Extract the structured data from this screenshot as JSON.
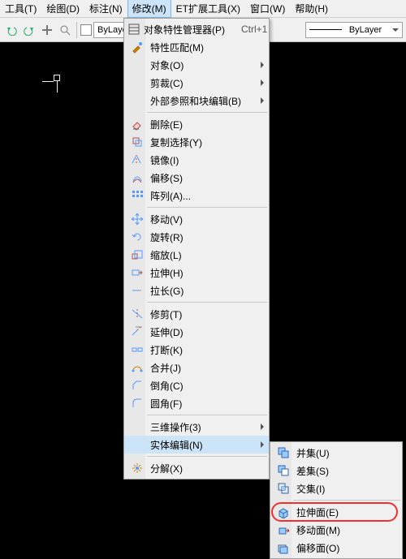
{
  "menubar": {
    "items": [
      {
        "label": "工具(T)"
      },
      {
        "label": "绘图(D)"
      },
      {
        "label": "标注(N)"
      },
      {
        "label": "修改(M)",
        "active": true
      },
      {
        "label": "ET扩展工具(X)"
      },
      {
        "label": "窗口(W)"
      },
      {
        "label": "帮助(H)"
      }
    ]
  },
  "toolbar": {
    "layer_label": "ByLayer",
    "linetype_label": "ByLayer"
  },
  "menu_modify": {
    "items": [
      {
        "icon": "properties",
        "label": "对象特性管理器(P)",
        "shortcut": "Ctrl+1"
      },
      {
        "icon": "match",
        "label": "特性匹配(M)"
      },
      {
        "icon": "",
        "label": "对象(O)",
        "sub": true
      },
      {
        "icon": "",
        "label": "剪裁(C)",
        "sub": true
      },
      {
        "icon": "",
        "label": "外部参照和块编辑(B)",
        "sub": true
      },
      {
        "sep": true
      },
      {
        "icon": "erase",
        "label": "删除(E)"
      },
      {
        "icon": "copy",
        "label": "复制选择(Y)"
      },
      {
        "icon": "mirror",
        "label": "镜像(I)"
      },
      {
        "icon": "offset",
        "label": "偏移(S)"
      },
      {
        "icon": "array",
        "label": "阵列(A)..."
      },
      {
        "sep": true
      },
      {
        "icon": "move",
        "label": "移动(V)"
      },
      {
        "icon": "rotate",
        "label": "旋转(R)"
      },
      {
        "icon": "scale",
        "label": "缩放(L)"
      },
      {
        "icon": "stretch",
        "label": "拉伸(H)"
      },
      {
        "icon": "lengthen",
        "label": "拉长(G)"
      },
      {
        "sep": true
      },
      {
        "icon": "trim",
        "label": "修剪(T)"
      },
      {
        "icon": "extend",
        "label": "延伸(D)"
      },
      {
        "icon": "break",
        "label": "打断(K)"
      },
      {
        "icon": "join",
        "label": "合并(J)"
      },
      {
        "icon": "chamfer",
        "label": "倒角(C)"
      },
      {
        "icon": "fillet",
        "label": "圆角(F)"
      },
      {
        "sep": true
      },
      {
        "icon": "",
        "label": "三维操作(3)",
        "sub": true
      },
      {
        "icon": "",
        "label": "实体编辑(N)",
        "sub": true,
        "hl": true
      },
      {
        "sep": true
      },
      {
        "icon": "explode",
        "label": "分解(X)"
      }
    ]
  },
  "menu_solidedit": {
    "items": [
      {
        "icon": "union",
        "label": "并集(U)"
      },
      {
        "icon": "subtract",
        "label": "差集(S)"
      },
      {
        "icon": "intersect",
        "label": "交集(I)"
      },
      {
        "sep": true
      },
      {
        "icon": "extrudeface",
        "label": "拉伸面(E)",
        "ring": true
      },
      {
        "icon": "moveface",
        "label": "移动面(M)"
      },
      {
        "icon": "offsetface",
        "label": "偏移面(O)"
      }
    ]
  }
}
